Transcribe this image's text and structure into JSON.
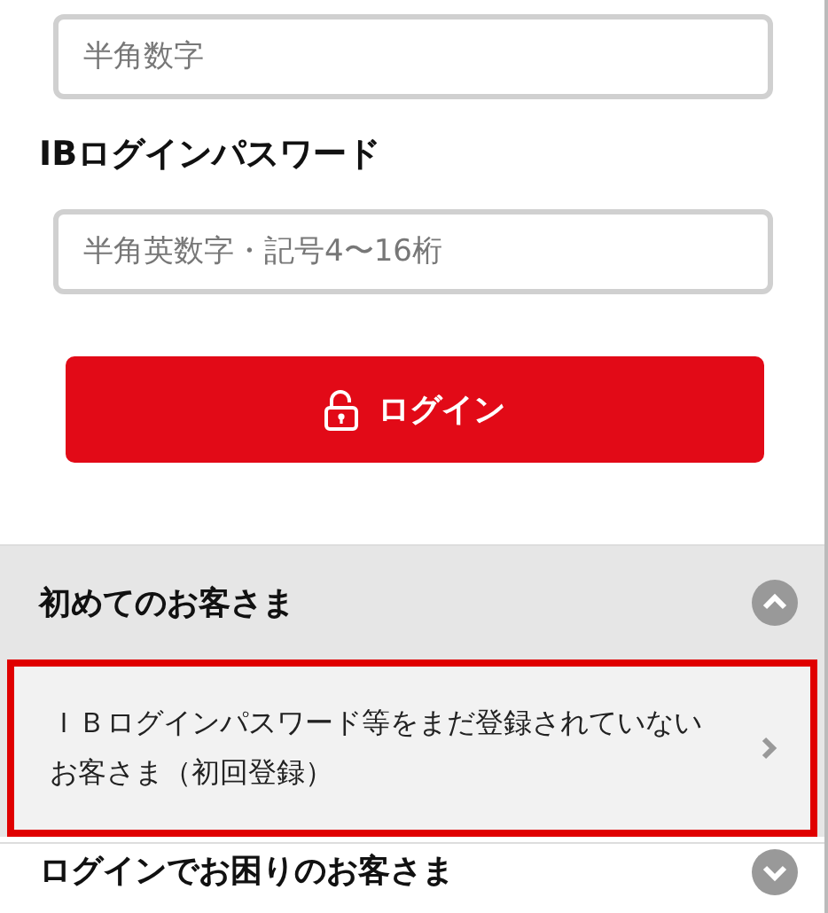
{
  "login_form": {
    "fields": [
      {
        "placeholder": "半角数字"
      },
      {
        "label": "IBログインパスワード",
        "placeholder": "半角英数字・記号4〜16桁"
      }
    ],
    "login_button": {
      "label": "ログイン"
    }
  },
  "sections": [
    {
      "title": "初めてのお客さま",
      "expanded": true,
      "items": [
        {
          "text": "ＩＢログインパスワード等をまだ登録されていないお客さま（初回登録）",
          "highlighted": true
        }
      ]
    },
    {
      "title": "ログインでお困りのお客さま",
      "expanded": false
    }
  ]
}
